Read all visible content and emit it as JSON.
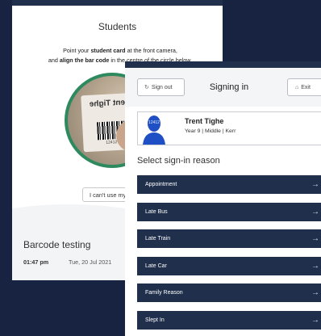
{
  "students_screen": {
    "title": "Students",
    "instruction": {
      "line1_pre": "Point your ",
      "line1_bold": "student card",
      "line1_post": " at the front camera,",
      "line2_pre": "and ",
      "line2_bold": "align the bar code",
      "line2_post": " in the centre of the circle below."
    },
    "camera_card_text": "Trent Tighe",
    "camera_card_number": "12412",
    "cant_use_button": "I can't use my card",
    "barcode_title": "Barcode testing",
    "time": "01:47 pm",
    "date": "Tue, 20 Jul 2021"
  },
  "signing_screen": {
    "signout_button": "Sign out",
    "title": "Signing in",
    "exit_button": "Exit",
    "student": {
      "badge_number": "12412",
      "name": "Trent Tighe",
      "meta": "Year 9 | Middle | Kerr"
    },
    "reason_heading": "Select sign-in reason",
    "reasons": [
      {
        "label": "Appointment"
      },
      {
        "label": "Late Bus"
      },
      {
        "label": "Late Train"
      },
      {
        "label": "Late Car"
      },
      {
        "label": "Family Reason"
      },
      {
        "label": "Slept In"
      }
    ],
    "arrow_glyph": "→"
  },
  "colors": {
    "background": "#172340",
    "navy_button": "#1f2f4c",
    "camera_ring": "#2e8a5e"
  }
}
